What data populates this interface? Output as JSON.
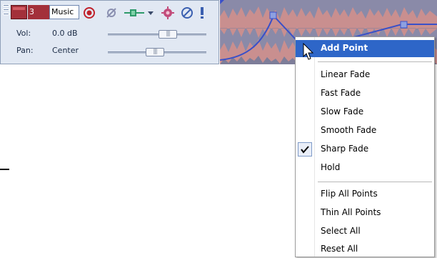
{
  "track": {
    "number": "3",
    "name": "Music",
    "colors": {
      "header_bg": "#e1e8f3",
      "track_red": "#a3303a"
    },
    "icons": [
      "record-arm-icon",
      "invert-phase-icon",
      "fx-chain-icon",
      "fx-dropdown-icon",
      "automation-icon",
      "mute-icon",
      "solo-icon"
    ],
    "volume": {
      "label": "Vol:",
      "value": "0.0 dB"
    },
    "pan": {
      "label": "Pan:",
      "value": "Center"
    }
  },
  "waveform": {
    "colors": {
      "bg": "#8a8aa8",
      "wave": "#c98f8f",
      "envelope": "#3a50c8"
    }
  },
  "context_menu": {
    "items": [
      {
        "label": "Add Point",
        "highlighted": true
      },
      {
        "label": "Linear Fade"
      },
      {
        "label": "Fast Fade"
      },
      {
        "label": "Slow Fade"
      },
      {
        "label": "Smooth Fade"
      },
      {
        "label": "Sharp Fade",
        "checked": true
      },
      {
        "label": "Hold"
      },
      {
        "label": "Flip All Points"
      },
      {
        "label": "Thin All Points"
      },
      {
        "label": "Select All"
      },
      {
        "label": "Reset All"
      }
    ],
    "colors": {
      "highlight": "#2e66c8"
    }
  }
}
